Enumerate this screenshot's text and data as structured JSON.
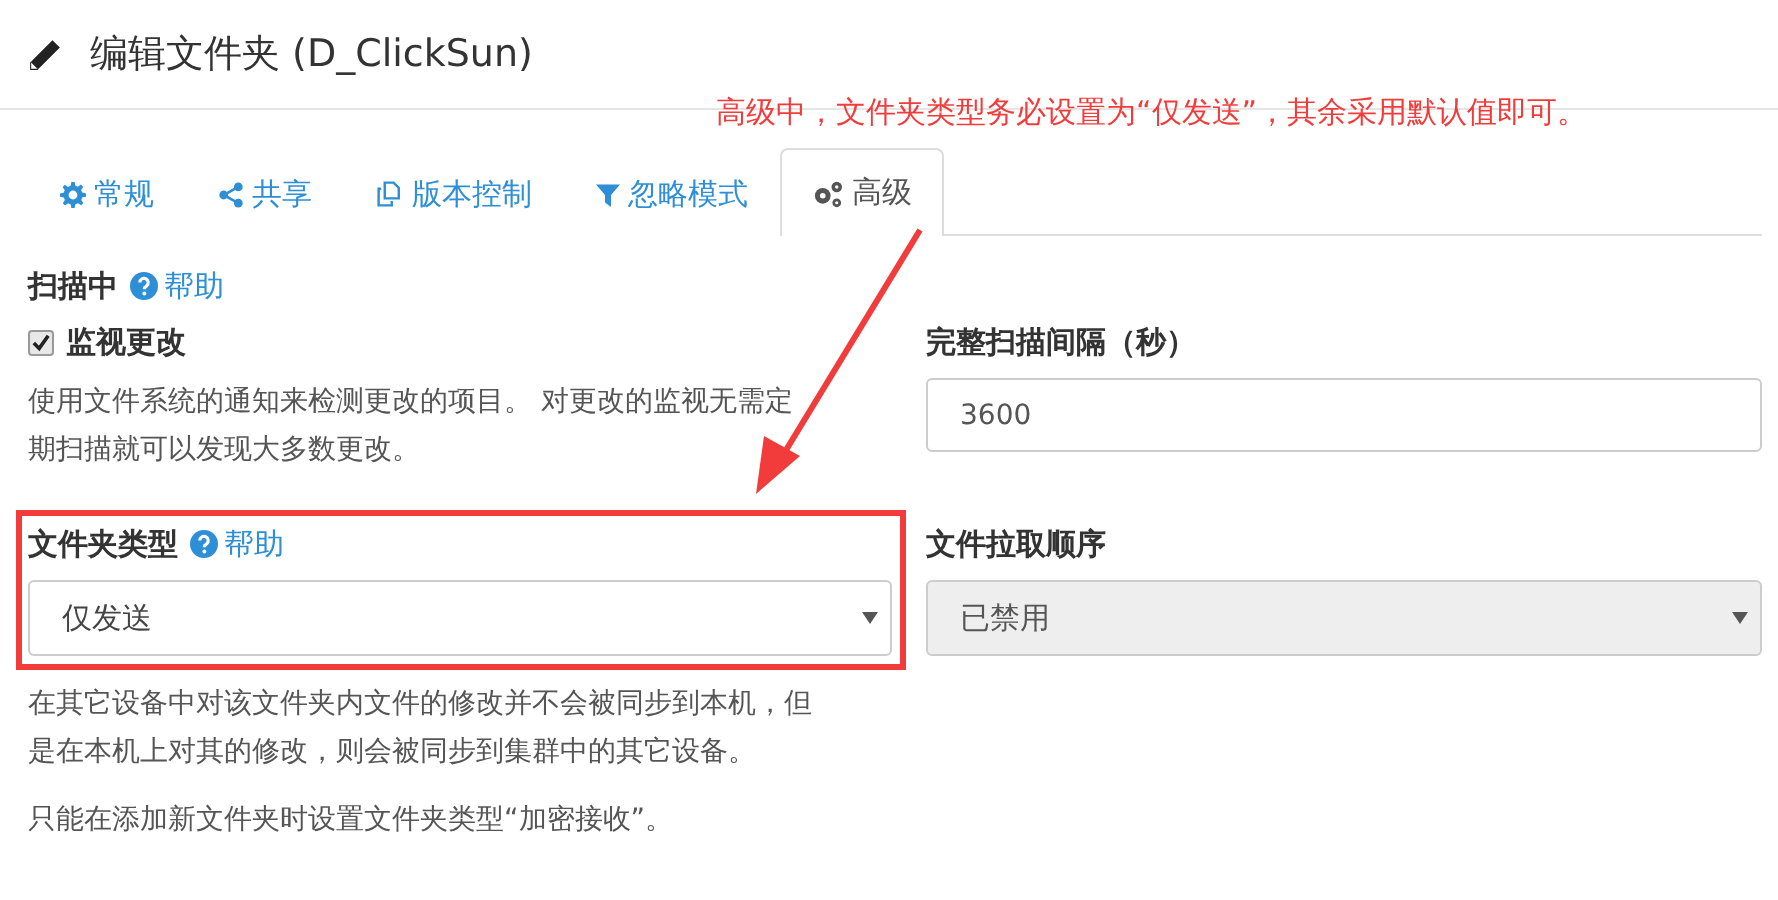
{
  "header": {
    "title": "编辑文件夹 (D_ClickSun)"
  },
  "annotation": {
    "text": "高级中，文件夹类型务必设置为“仅发送”，其余采用默认值即可。"
  },
  "tabs": [
    {
      "kind": "general",
      "label": "常规",
      "selected": false
    },
    {
      "kind": "sharing",
      "label": "共享",
      "selected": false
    },
    {
      "kind": "versioning",
      "label": "版本控制",
      "selected": false
    },
    {
      "kind": "ignore",
      "label": "忽略模式",
      "selected": false
    },
    {
      "kind": "advanced",
      "label": "高级",
      "selected": true
    }
  ],
  "scanning": {
    "title": "扫描中",
    "help": "帮助",
    "watch": {
      "label": "监视更改",
      "checked": true
    },
    "description": "使用文件系统的通知来检测更改的项目。 对更改的监视无需定期扫描就可以发现大多数更改。"
  },
  "rescan": {
    "label": "完整扫描间隔（秒）",
    "value": "3600"
  },
  "folder_type": {
    "label": "文件夹类型",
    "help": "帮助",
    "value": "仅发送",
    "disabled": false,
    "description": "在其它设备中对该文件夹内文件的修改并不会被同步到本机，但是在本机上对其的修改，则会被同步到集群中的其它设备。",
    "note": "只能在添加新文件夹时设置文件夹类型“加密接收”。"
  },
  "pull_order": {
    "label": "文件拉取顺序",
    "value": "已禁用",
    "disabled": true
  }
}
